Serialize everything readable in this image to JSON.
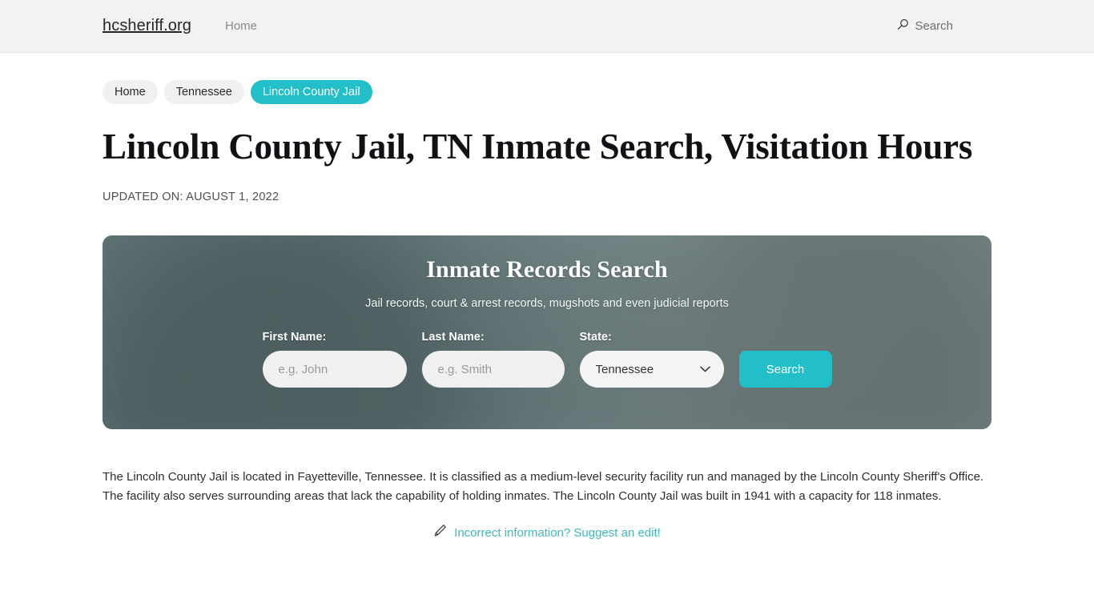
{
  "navbar": {
    "brand": "hcsheriff.org",
    "links": [
      {
        "label": "Home",
        "icon": "home-link"
      }
    ],
    "search": {
      "label": "Search",
      "icon": "search-icon"
    }
  },
  "breadcrumb": [
    {
      "label": "Home",
      "active": false
    },
    {
      "label": "Tennessee",
      "active": false
    },
    {
      "label": "Lincoln County Jail",
      "active": true
    }
  ],
  "page": {
    "title": "Lincoln County Jail, TN Inmate Search, Visitation Hours",
    "updated_on": "UPDATED ON: AUGUST 1, 2022",
    "body": "The Lincoln County Jail is located in Fayetteville, Tennessee. It is classified as a medium-level security facility run and managed by the Lincoln County Sheriff's Office. The facility also serves surrounding areas that lack the capability of holding inmates. The Lincoln County Jail was built in 1941 with a capacity for 118 inmates."
  },
  "search_panel": {
    "title": "Inmate Records Search",
    "subtitle": "Jail records, court & arrest records, mugshots and even judicial reports",
    "fields": {
      "first_name": {
        "label": "First Name:",
        "placeholder": "e.g. John",
        "value": ""
      },
      "last_name": {
        "label": "Last Name:",
        "placeholder": "e.g. Smith",
        "value": ""
      },
      "state": {
        "label": "State:",
        "selected": "Tennessee",
        "options": [
          "Tennessee"
        ],
        "icon": "chevron-down-icon"
      }
    },
    "submit_label": "Search"
  },
  "suggest_edit": {
    "icon": "pencil-icon",
    "label": "Incorrect information? Suggest an edit!"
  },
  "colors": {
    "accent_teal": "#22bfc8",
    "link_teal": "#3fb8bd",
    "header_bg": "#f2f2f2",
    "pill_bg": "#f0f0f0",
    "panel_base": "#7b9698"
  }
}
